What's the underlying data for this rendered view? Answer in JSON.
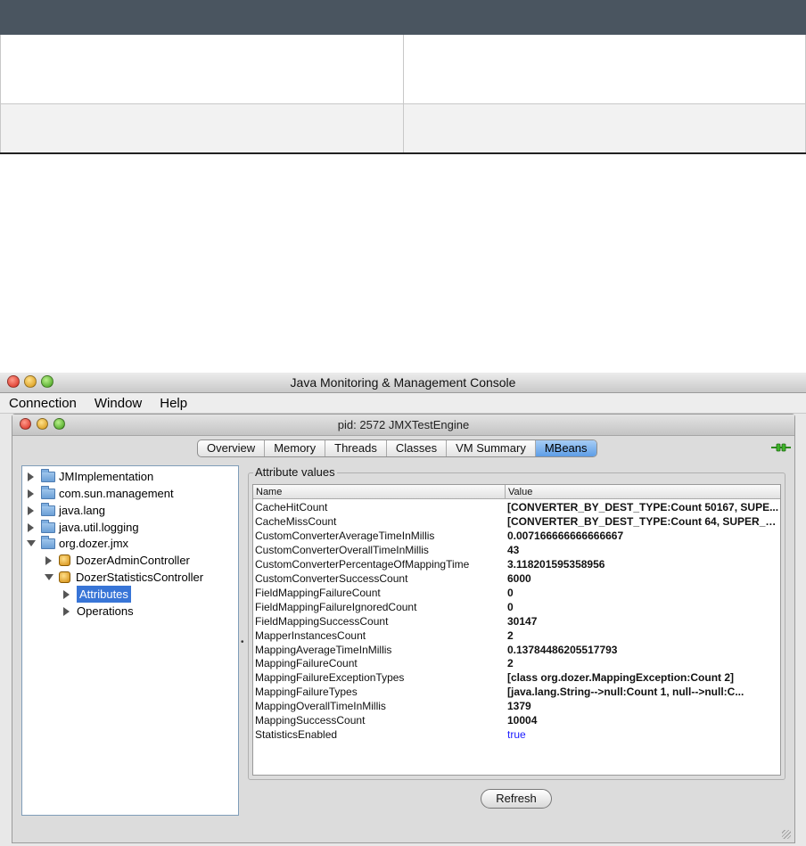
{
  "window": {
    "title": "Java Monitoring & Management Console",
    "menu": [
      "Connection",
      "Window",
      "Help"
    ]
  },
  "inner_window": {
    "title": "pid: 2572 JMXTestEngine",
    "tabs": [
      {
        "label": "Overview",
        "active": false
      },
      {
        "label": "Memory",
        "active": false
      },
      {
        "label": "Threads",
        "active": false
      },
      {
        "label": "Classes",
        "active": false
      },
      {
        "label": "VM Summary",
        "active": false
      },
      {
        "label": "MBeans",
        "active": true
      }
    ]
  },
  "tree": {
    "nodes": [
      {
        "label": "JMImplementation",
        "icon": "folder-icon",
        "expanded": false
      },
      {
        "label": "com.sun.management",
        "icon": "folder-icon",
        "expanded": false
      },
      {
        "label": "java.lang",
        "icon": "folder-icon",
        "expanded": false
      },
      {
        "label": "java.util.logging",
        "icon": "folder-icon",
        "expanded": false
      },
      {
        "label": "org.dozer.jmx",
        "icon": "folder-icon",
        "expanded": true
      },
      {
        "label": "DozerAdminController",
        "icon": "mbean-icon",
        "expanded": false
      },
      {
        "label": "DozerStatisticsController",
        "icon": "mbean-icon",
        "expanded": true
      },
      {
        "label": "Attributes",
        "icon": "",
        "expanded": false,
        "selected": true
      },
      {
        "label": "Operations",
        "icon": "",
        "expanded": false
      }
    ]
  },
  "attributes": {
    "group_label": "Attribute values",
    "columns": [
      "Name",
      "Value"
    ],
    "rows": [
      {
        "name": "CacheHitCount",
        "value": "[CONVERTER_BY_DEST_TYPE:Count 50167, SUPE..."
      },
      {
        "name": "CacheMissCount",
        "value": "[CONVERTER_BY_DEST_TYPE:Count 64, SUPER_T..."
      },
      {
        "name": "CustomConverterAverageTimeInMillis",
        "value": "0.007166666666666667"
      },
      {
        "name": "CustomConverterOverallTimeInMillis",
        "value": "43"
      },
      {
        "name": "CustomConverterPercentageOfMappingTime",
        "value": "3.118201595358956"
      },
      {
        "name": "CustomConverterSuccessCount",
        "value": "6000"
      },
      {
        "name": "FieldMappingFailureCount",
        "value": "0"
      },
      {
        "name": "FieldMappingFailureIgnoredCount",
        "value": "0"
      },
      {
        "name": "FieldMappingSuccessCount",
        "value": "30147"
      },
      {
        "name": "MapperInstancesCount",
        "value": "2"
      },
      {
        "name": "MappingAverageTimeInMillis",
        "value": "0.13784486205517793"
      },
      {
        "name": "MappingFailureCount",
        "value": "2"
      },
      {
        "name": "MappingFailureExceptionTypes",
        "value": "[class org.dozer.MappingException:Count 2]"
      },
      {
        "name": "MappingFailureTypes",
        "value": "[java.lang.String-->null:Count 1, null-->null:C..."
      },
      {
        "name": "MappingOverallTimeInMillis",
        "value": "1379"
      },
      {
        "name": "MappingSuccessCount",
        "value": "10004"
      },
      {
        "name": "StatisticsEnabled",
        "value": "true"
      }
    ]
  },
  "refresh_label": "Refresh"
}
